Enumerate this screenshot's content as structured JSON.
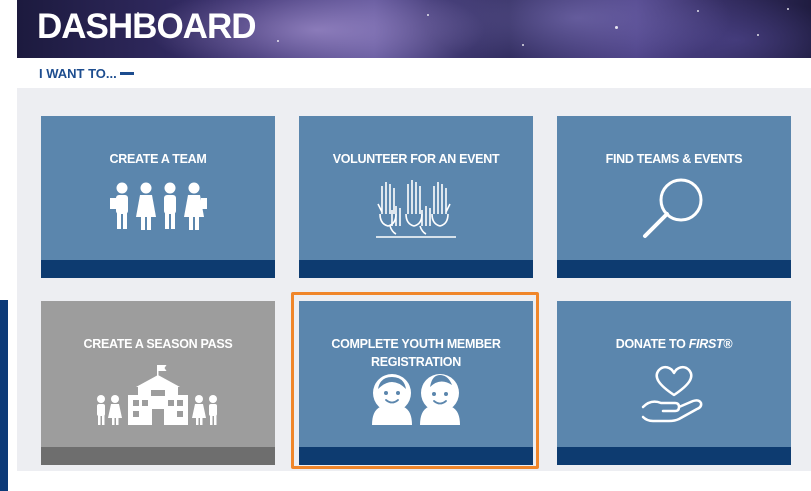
{
  "header": {
    "title": "DASHBOARD"
  },
  "menu": {
    "toggle_label": "I WANT TO..."
  },
  "tiles": [
    {
      "label": "CREATE A TEAM",
      "icon": "team-people-icon",
      "style": "blue"
    },
    {
      "label": "VOLUNTEER FOR AN EVENT",
      "icon": "raised-hands-icon",
      "style": "blue"
    },
    {
      "label": "FIND TEAMS & EVENTS",
      "icon": "magnifier-icon",
      "style": "blue"
    },
    {
      "label": "CREATE A SEASON PASS",
      "icon": "school-building-icon",
      "style": "gray"
    },
    {
      "label": "COMPLETE YOUTH MEMBER REGISTRATION",
      "icon": "youth-faces-icon",
      "style": "blue",
      "highlighted": true
    },
    {
      "label_prefix": "DONATE TO ",
      "label_brand": "FIRST",
      "label_suffix": "®",
      "icon": "heart-hand-icon",
      "style": "blue"
    }
  ],
  "colors": {
    "tile_blue": "#5b86ad",
    "tile_gray": "#9d9d9d",
    "stripe_navy": "#0d3b70",
    "highlight_orange": "#f0862a",
    "accent_blue": "#1d4d8f",
    "content_bg": "#edeef2"
  }
}
